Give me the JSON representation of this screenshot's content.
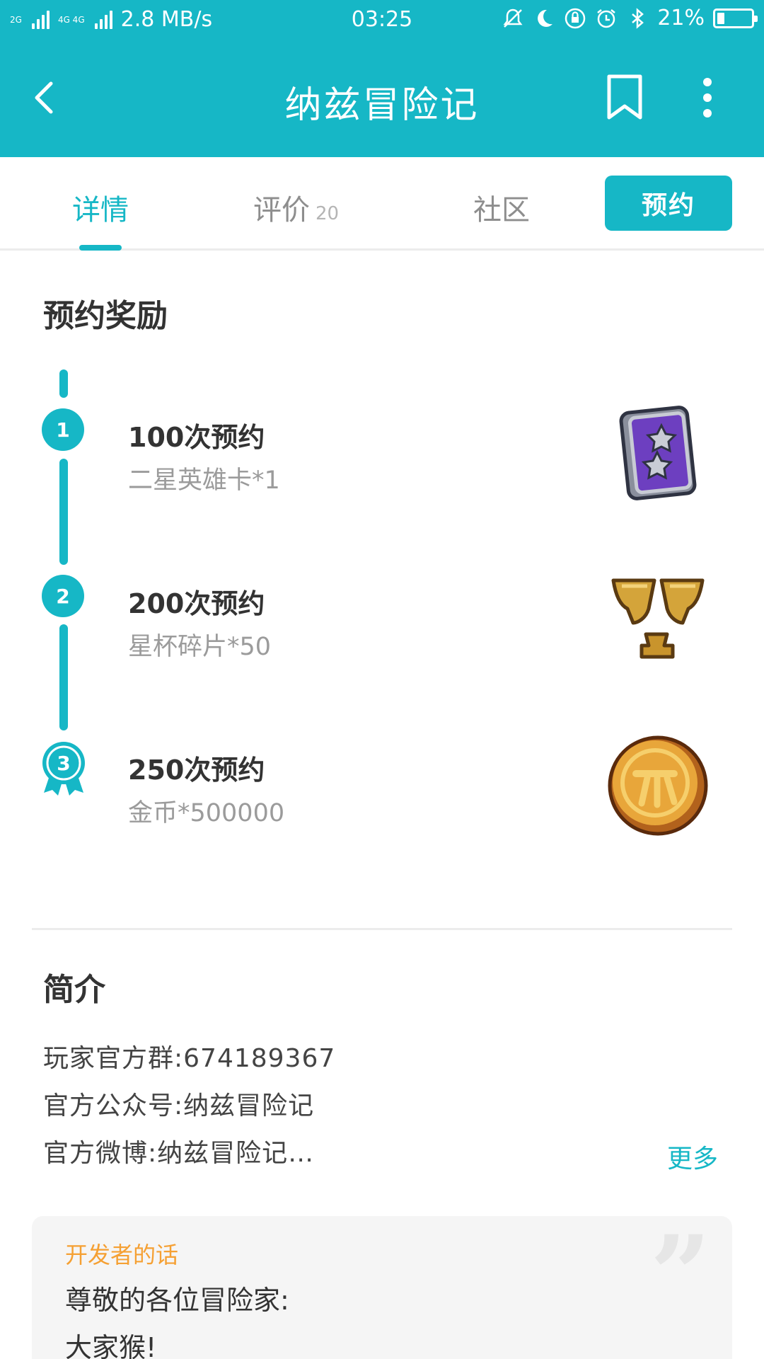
{
  "status_bar": {
    "network_left": "2G",
    "network_right": "4G 4G",
    "speed": "2.8 MB/s",
    "time": "03:25",
    "battery_percent": "21%",
    "battery_level": 0.21
  },
  "app_bar": {
    "title": "纳兹冒险记"
  },
  "tabs": {
    "detail": "详情",
    "review": "评价",
    "review_count": "20",
    "community": "社区",
    "reserve": "预约"
  },
  "rewards": {
    "title": "预约奖励",
    "items": [
      {
        "step": "1",
        "name": "100次预约",
        "desc": "二星英雄卡*1"
      },
      {
        "step": "2",
        "name": "200次预约",
        "desc": "星杯碎片*50"
      },
      {
        "step": "3",
        "name": "250次预约",
        "desc": "金币*500000"
      }
    ]
  },
  "intro": {
    "title": "简介",
    "lines": [
      "玩家官方群:674189367",
      "官方公众号:纳兹冒险记",
      "官方微博:纳兹冒险记…"
    ],
    "more": "更多"
  },
  "developer": {
    "label": "开发者的话",
    "lines": [
      "尊敬的各位冒险家:",
      "大家猴!"
    ]
  },
  "colors": {
    "accent": "#16b7c6",
    "developer_label": "#f5a033"
  }
}
